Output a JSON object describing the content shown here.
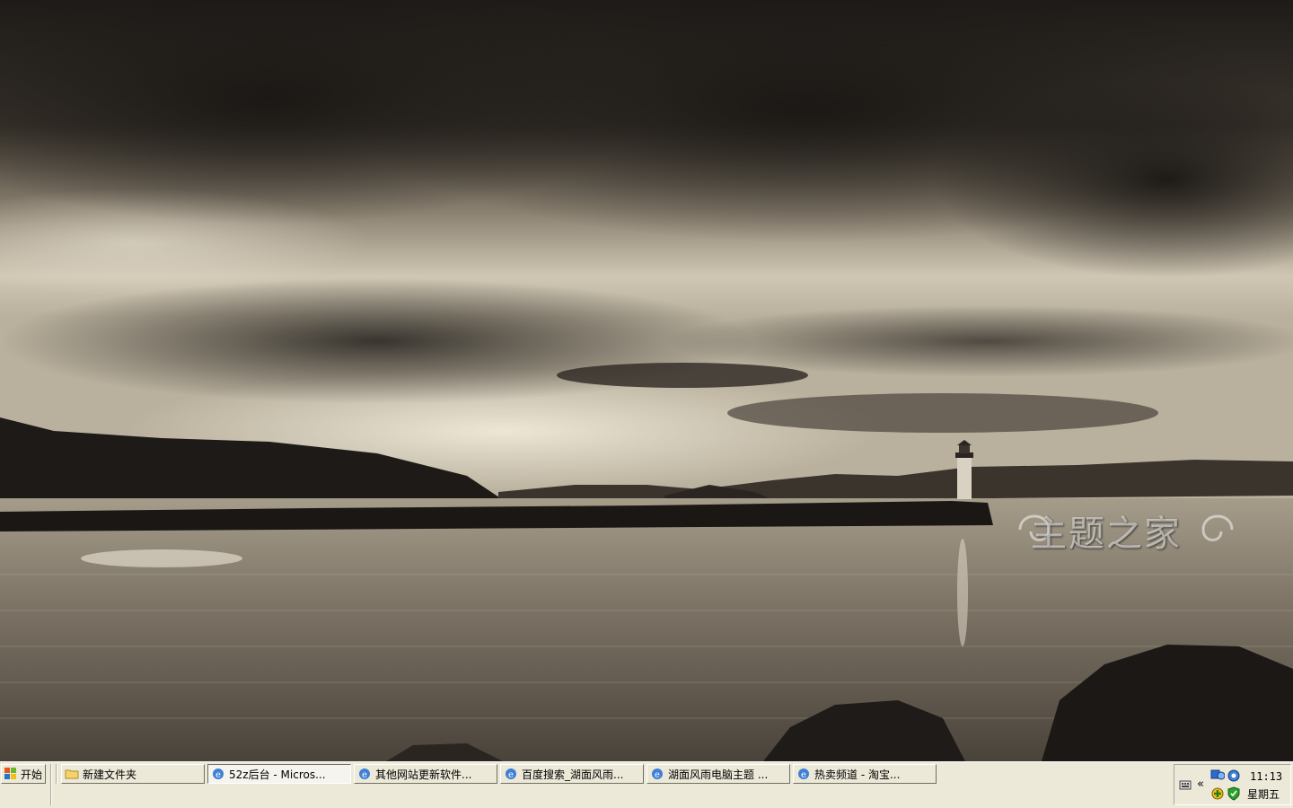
{
  "desktop": {
    "wallpaper": "sepia-lake-lighthouse",
    "watermark_text": "主题之家"
  },
  "taskbar": {
    "start_label": "开始",
    "tasks": [
      {
        "label": "新建文件夹",
        "icon": "folder-icon",
        "active": false
      },
      {
        "label": "52z后台 - Micros...",
        "icon": "ie-icon",
        "active": true
      },
      {
        "label": "其他网站更新软件...",
        "icon": "ie-icon",
        "active": false
      },
      {
        "label": "百度搜索_湖面风雨...",
        "icon": "ie-icon",
        "active": false
      },
      {
        "label": "湖面风雨电脑主题 ...",
        "icon": "ie-icon",
        "active": false
      },
      {
        "label": "热卖频道 - 淘宝...",
        "icon": "ie-icon",
        "active": false
      }
    ],
    "tray": {
      "chevron": "«",
      "icons": [
        "keyboard-icon",
        "network-icon",
        "security-shield-icon",
        "update-icon"
      ],
      "time": "11:13",
      "day": "星期五"
    }
  },
  "colors": {
    "taskbar_bg": "#ece9d8",
    "sepia_dark": "#2a2520",
    "sepia_light": "#d8d0bf"
  }
}
